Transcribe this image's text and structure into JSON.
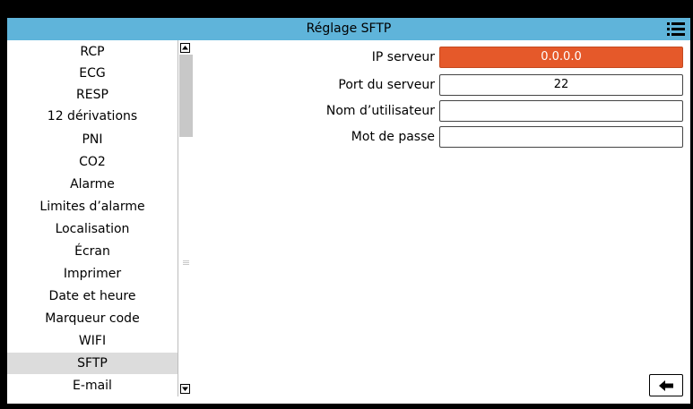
{
  "header": {
    "title": "Réglage SFTP",
    "menu_icon": "list-menu-icon"
  },
  "sidebar": {
    "items": [
      {
        "label": "RCP"
      },
      {
        "label": "ECG"
      },
      {
        "label": "RESP"
      },
      {
        "label": "12 dérivations"
      },
      {
        "label": "PNI"
      },
      {
        "label": "CO2"
      },
      {
        "label": "Alarme"
      },
      {
        "label": "Limites d’alarme"
      },
      {
        "label": "Localisation"
      },
      {
        "label": "Écran"
      },
      {
        "label": "Imprimer"
      },
      {
        "label": "Date et heure"
      },
      {
        "label": "Marqueur code"
      },
      {
        "label": "WIFI"
      },
      {
        "label": "SFTP"
      },
      {
        "label": "E-mail"
      }
    ],
    "active_item": "SFTP"
  },
  "form": {
    "server_ip": {
      "label": "IP serveur",
      "value": "0.0.0.0"
    },
    "server_port": {
      "label": "Port du serveur",
      "value": "22"
    },
    "username": {
      "label": "Nom d’utilisateur",
      "value": ""
    },
    "password": {
      "label": "Mot de passe",
      "value": ""
    }
  },
  "footer": {
    "back_icon": "back-arrow-icon"
  },
  "colors": {
    "title_bar": "#5fb4da",
    "active_field": "#e5592a",
    "active_item": "#dcdcdc"
  }
}
